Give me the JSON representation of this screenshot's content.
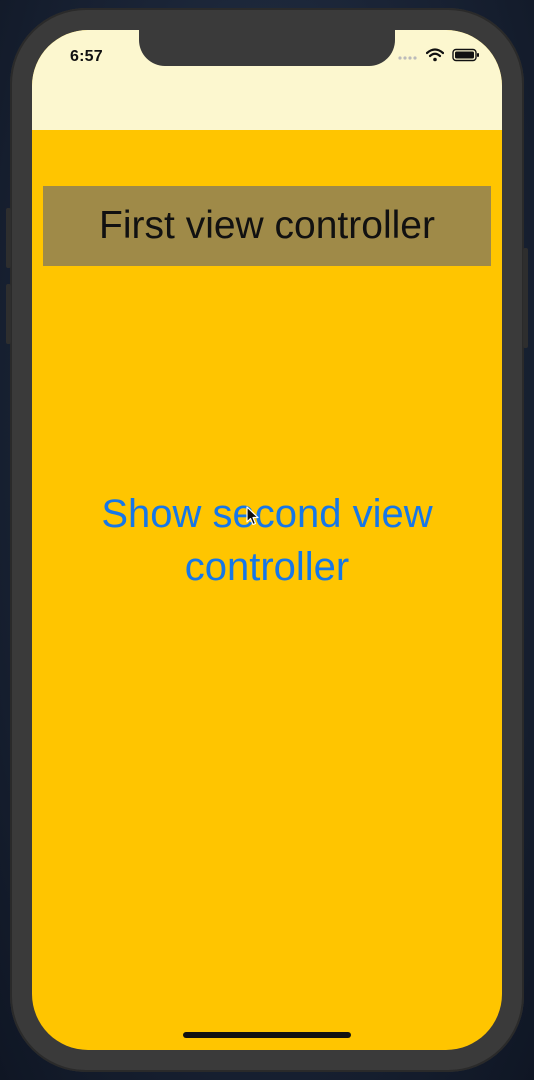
{
  "status_bar": {
    "time": "6:57",
    "icons": [
      "cellular-dots-icon",
      "wifi-icon",
      "battery-icon"
    ]
  },
  "header": {
    "title": "First view controller"
  },
  "main": {
    "show_button_label": "Show second view controller"
  },
  "colors": {
    "background": "#FFC500",
    "status_area": "#FCF7CF",
    "header_box": "#9F8A48",
    "button_text": "#1677E8"
  }
}
